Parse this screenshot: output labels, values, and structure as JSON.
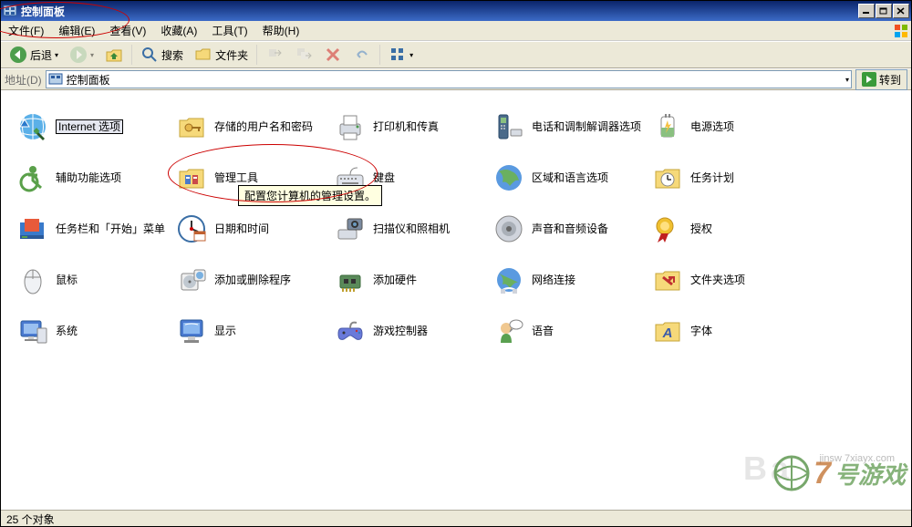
{
  "titlebar": {
    "title": "控制面板"
  },
  "menubar": {
    "items": [
      "文件(F)",
      "编辑(E)",
      "查看(V)",
      "收藏(A)",
      "工具(T)",
      "帮助(H)"
    ]
  },
  "toolbar": {
    "back": "后退",
    "search": "搜索",
    "folders": "文件夹"
  },
  "addressbar": {
    "label": "地址(D)",
    "value": "控制面板",
    "go": "转到"
  },
  "tooltip": "配置您计算机的管理设置。",
  "items": [
    {
      "name": "internet-options",
      "label": "Internet 选项",
      "selected": true
    },
    {
      "name": "stored-users-passwords",
      "label": "存储的用户名和密码"
    },
    {
      "name": "printers-faxes",
      "label": "打印机和传真"
    },
    {
      "name": "phone-modem",
      "label": "电话和调制解调器选项"
    },
    {
      "name": "power-options",
      "label": "电源选项"
    },
    {
      "name": "accessibility",
      "label": "辅助功能选项"
    },
    {
      "name": "admin-tools",
      "label": "管理工具"
    },
    {
      "name": "keyboard",
      "label": "键盘"
    },
    {
      "name": "regional-language",
      "label": "区域和语言选项"
    },
    {
      "name": "scheduled-tasks",
      "label": "任务计划"
    },
    {
      "name": "taskbar-start",
      "label": "任务栏和「开始」菜单"
    },
    {
      "name": "date-time",
      "label": "日期和时间"
    },
    {
      "name": "scanners-cameras",
      "label": "扫描仪和照相机"
    },
    {
      "name": "sounds-audio",
      "label": "声音和音频设备"
    },
    {
      "name": "licensing",
      "label": "授权"
    },
    {
      "name": "mouse",
      "label": "鼠标"
    },
    {
      "name": "add-remove-programs",
      "label": "添加或删除程序"
    },
    {
      "name": "add-hardware",
      "label": "添加硬件"
    },
    {
      "name": "network-connections",
      "label": "网络连接"
    },
    {
      "name": "folder-options",
      "label": "文件夹选项"
    },
    {
      "name": "system",
      "label": "系统"
    },
    {
      "name": "display",
      "label": "显示"
    },
    {
      "name": "game-controllers",
      "label": "游戏控制器"
    },
    {
      "name": "speech",
      "label": "语音"
    },
    {
      "name": "fonts",
      "label": "字体"
    }
  ],
  "statusbar": {
    "text": "25 个对象"
  },
  "watermark": {
    "brand": "号游戏",
    "url": "jinsw   7xiayx.com",
    "bd": "Ba"
  }
}
